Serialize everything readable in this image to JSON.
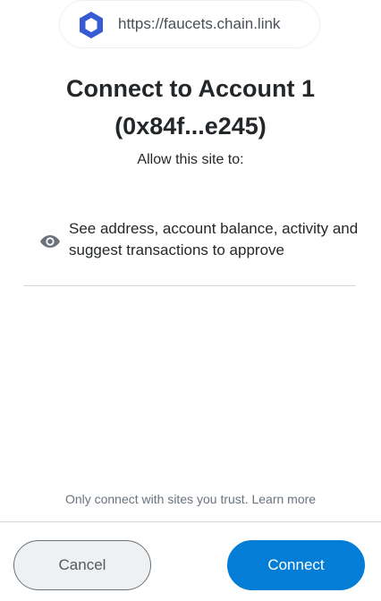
{
  "site": {
    "url": "https://faucets.chain.link",
    "icon": "chainlink-hexagon-icon",
    "icon_color": "#375bd2"
  },
  "header": {
    "title_line1": "Connect to Account 1",
    "title_line2": "(0x84f...e245)"
  },
  "permissions": {
    "intro": "Allow this site to:",
    "items": [
      {
        "icon": "eye-icon",
        "text": "See address, account balance, activity and suggest transactions to approve"
      }
    ]
  },
  "footer": {
    "trust_text": "Only connect with sites you trust.",
    "learn_more": "Learn more",
    "cancel_label": "Cancel",
    "connect_label": "Connect"
  },
  "colors": {
    "primary": "#037dd6",
    "text": "#24272a",
    "muted": "#6a737d"
  }
}
